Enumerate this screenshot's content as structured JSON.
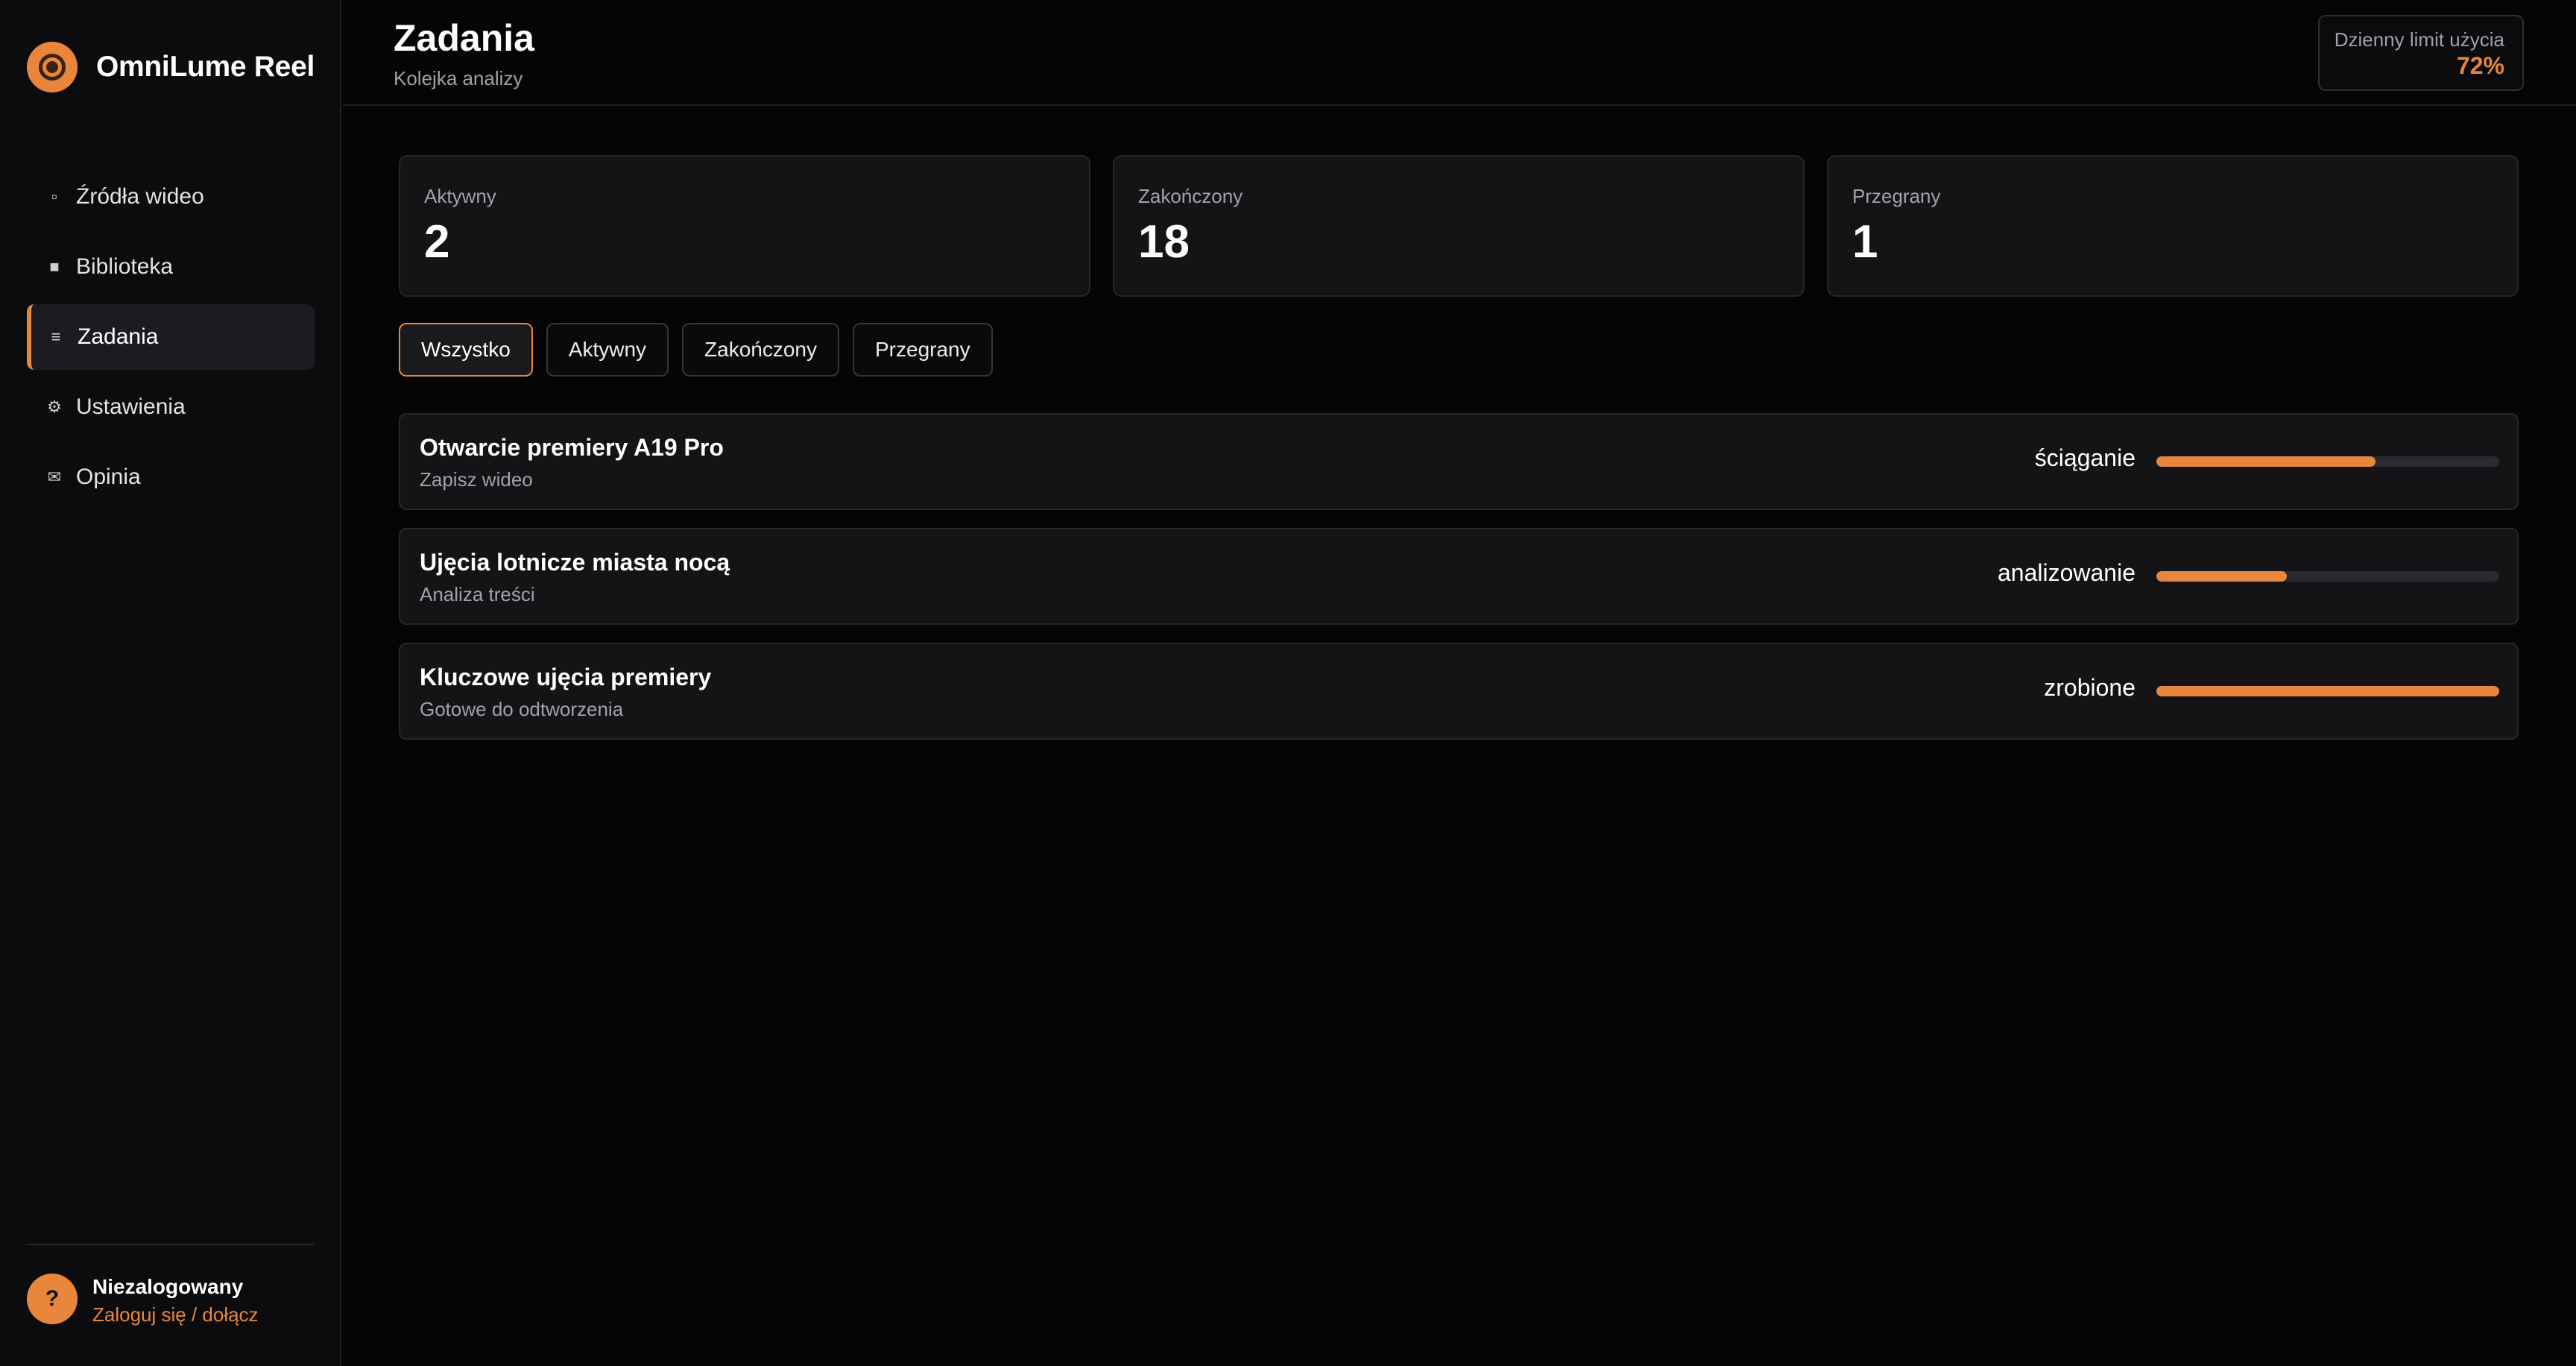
{
  "app": {
    "name": "OmniLume Reel",
    "accent": "#e8873b"
  },
  "sidebar": {
    "items": [
      {
        "label": "Źródła wideo",
        "icon": "▫",
        "active": false
      },
      {
        "label": "Biblioteka",
        "icon": "■",
        "active": false
      },
      {
        "label": "Zadania",
        "icon": "≡",
        "active": true
      },
      {
        "label": "Ustawienia",
        "icon": "⚙",
        "active": false
      },
      {
        "label": "Opinia",
        "icon": "✉",
        "active": false
      }
    ],
    "user": {
      "avatar_symbol": "?",
      "name": "Niezalogowany",
      "login_label": "Zaloguj się / dołącz"
    }
  },
  "header": {
    "title": "Zadania",
    "subtitle": "Kolejka analizy",
    "usage_label": "Dzienny limit użycia",
    "usage_value": "72%"
  },
  "stats": [
    {
      "label": "Aktywny",
      "value": "2"
    },
    {
      "label": "Zakończony",
      "value": "18"
    },
    {
      "label": "Przegrany",
      "value": "1"
    }
  ],
  "filters": [
    {
      "label": "Wszystko",
      "active": true
    },
    {
      "label": "Aktywny",
      "active": false
    },
    {
      "label": "Zakończony",
      "active": false
    },
    {
      "label": "Przegrany",
      "active": false
    }
  ],
  "jobs": [
    {
      "title": "Otwarcie premiery A19 Pro",
      "subtitle": "Zapisz wideo",
      "status": "ściąganie",
      "progress": 0.64
    },
    {
      "title": "Ujęcia lotnicze miasta nocą",
      "subtitle": "Analiza treści",
      "status": "analizowanie",
      "progress": 0.38
    },
    {
      "title": "Kluczowe ujęcia premiery",
      "subtitle": "Gotowe do odtworzenia",
      "status": "zrobione",
      "progress": 1.0
    }
  ]
}
